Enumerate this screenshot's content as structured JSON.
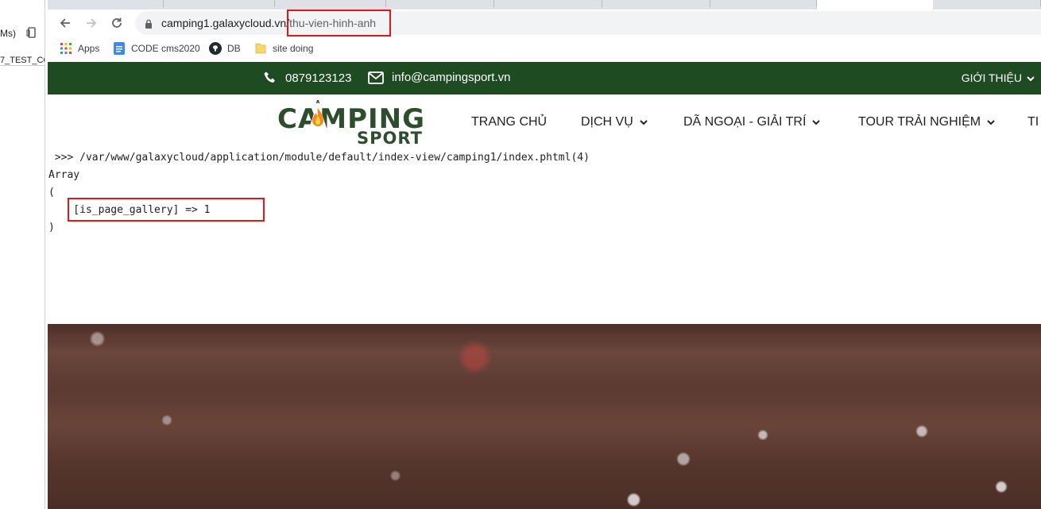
{
  "left_pane": {
    "text_top": "Ms)",
    "text_row": "7_TEST_CC"
  },
  "toolbar": {
    "url_host": "camping1.galaxycloud.vn/",
    "url_path": "thu-vien-hinh-anh"
  },
  "bookmarks": [
    {
      "label": "Apps",
      "icon": "apps-grid-icon"
    },
    {
      "label": "CODE cms2020",
      "icon": "doc-icon"
    },
    {
      "label": "DB",
      "icon": "github-icon"
    },
    {
      "label": "site doing",
      "icon": "folder-icon"
    }
  ],
  "site": {
    "phone": "0879123123",
    "email": "info@campingsport.vn",
    "about": "GIỚI THIỆU",
    "logo_top": "CAMPING",
    "logo_bottom": "SPORT",
    "nav": [
      "TRANG CHỦ",
      "DỊCH VỤ",
      "DÃ NGOẠI - GIẢI TRÍ",
      "TOUR TRẢI NGHIỆM",
      "TI"
    ]
  },
  "debug": {
    "line1": " >>> /var/www/galaxycloud/application/module/default/index-view/camping1/index.phtml(4)",
    "line2": "Array",
    "line3": "(",
    "line4": "    [is_page_gallery] => 1",
    "line5": ")"
  },
  "colors": {
    "topbar": "#1e4b22",
    "logo": "#2d4d2c",
    "annotation": "#e01818",
    "hero": "#5c3a31"
  }
}
